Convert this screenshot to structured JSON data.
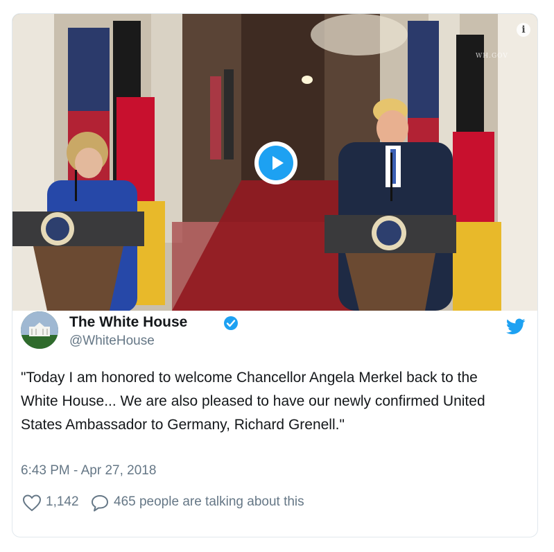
{
  "tweet": {
    "author_name": "The White House",
    "author_handle": "@WhiteHouse",
    "text": "\"Today I am honored to welcome Chancellor Angela Merkel back to the White House... We are also pleased to have our newly confirmed United States Ambassador to Germany, Richard Grenell.\"",
    "timestamp": "6:43 PM - Apr 27, 2018",
    "like_count": "1,142",
    "talking_text": "465 people are talking about this"
  },
  "media": {
    "watermark": "WH.GOV",
    "info_label": "i",
    "play_icon": "play-icon"
  },
  "icons": {
    "verified": "verified-badge-icon",
    "brand": "twitter-bird-icon",
    "like": "heart-icon",
    "reply": "speech-bubble-icon"
  },
  "colors": {
    "accent": "#1da1f2",
    "text": "#14171a",
    "muted": "#657786",
    "border": "#e1e8ed"
  }
}
